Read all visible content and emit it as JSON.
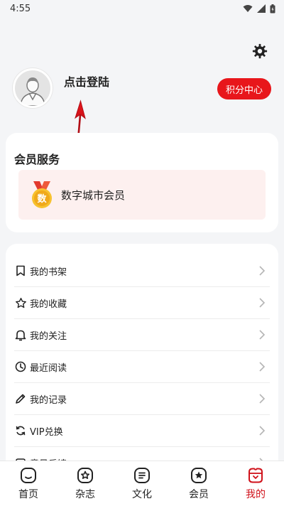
{
  "status_bar": {
    "time": "4:55"
  },
  "profile": {
    "login_text": "点击登陆",
    "points_button": "积分中心"
  },
  "member_service": {
    "title": "会员服务",
    "item_label": "数字城市会员",
    "medal_char": "数"
  },
  "menu": [
    {
      "label": "我的书架",
      "icon": "bookmark-icon"
    },
    {
      "label": "我的收藏",
      "icon": "star-icon"
    },
    {
      "label": "我的关注",
      "icon": "bell-icon"
    },
    {
      "label": "最近阅读",
      "icon": "clock-icon"
    },
    {
      "label": "我的记录",
      "icon": "pencil-icon"
    },
    {
      "label": "VIP兑换",
      "icon": "refresh-icon"
    },
    {
      "label": "意见反馈",
      "icon": "feedback-icon"
    }
  ],
  "tabs": [
    {
      "label": "首页",
      "icon": "home-face-icon"
    },
    {
      "label": "杂志",
      "icon": "magazine-star-icon"
    },
    {
      "label": "文化",
      "icon": "culture-icon"
    },
    {
      "label": "会员",
      "icon": "member-star-icon"
    },
    {
      "label": "我的",
      "icon": "profile-icon",
      "active": true
    }
  ],
  "colors": {
    "accent": "#e8161b",
    "background": "#f4f5f7",
    "service_bg": "#fdf0ef"
  }
}
